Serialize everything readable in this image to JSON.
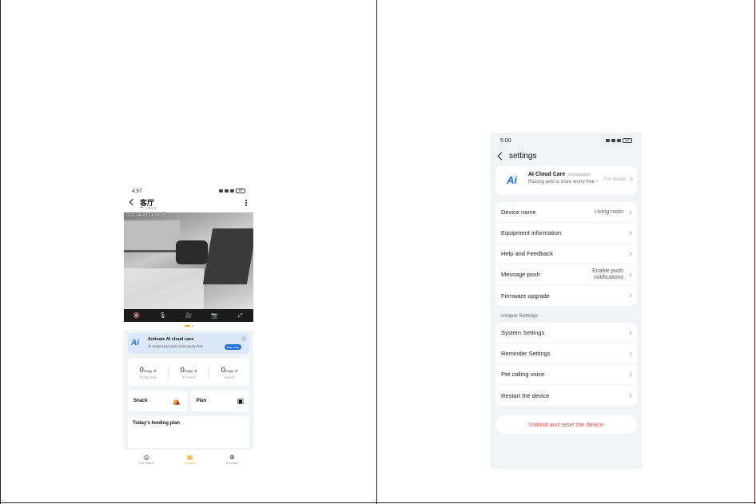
{
  "left_phone": {
    "status_time": "4:57",
    "battery": "97",
    "title": "客厅",
    "wifi_label": "2.4GHz",
    "video_timestamp": "2026-04-03 14:59:25",
    "video_controls": [
      "🔇",
      "🎙",
      "🎥",
      "📷",
      "⤢"
    ],
    "ai_banner": {
      "title": "Activate AI cloud care",
      "subtitle": "AI makes pet care more worry-free",
      "button": "Buy now",
      "logo": "Ai"
    },
    "stats": [
      {
        "value": "0",
        "unit": "Copy of",
        "label": "Today Fed"
      },
      {
        "value": "0",
        "unit": "Copy of",
        "label": "To Feed"
      },
      {
        "value": "0",
        "unit": "Copy of",
        "label": "Snack"
      }
    ],
    "snack_label": "Snack",
    "plan_label": "Plan",
    "feeding_plan_title": "Today's feeding plan",
    "tabs": [
      {
        "label": "Pet Status",
        "icon": "◎"
      },
      {
        "label": "Camera",
        "icon": "▦"
      },
      {
        "label": "Function",
        "icon": "⊕"
      }
    ]
  },
  "right_phone": {
    "status_time": "5:00",
    "battery": "97",
    "title": "settings",
    "ai_card": {
      "logo": "Ai",
      "title": "AI Cloud Care",
      "badge": "Not activated",
      "subtitle": "Raising pets is more worry-free ~",
      "details": "For details"
    },
    "items": [
      {
        "label": "Device name",
        "value": "Living room"
      },
      {
        "label": "Equipment information",
        "value": ""
      },
      {
        "label": "Help and Feedback",
        "value": ""
      },
      {
        "label": "Message push",
        "value": "Enable push notifications"
      },
      {
        "label": "Firmware upgrade",
        "value": ""
      }
    ],
    "section_title": "Unique Settings",
    "unique_items": [
      {
        "label": "System Settings"
      },
      {
        "label": "Reminder Settings"
      },
      {
        "label": "Pet calling voice"
      },
      {
        "label": "Restart the device"
      }
    ],
    "unbind_label": "Unbind and reset the device"
  }
}
